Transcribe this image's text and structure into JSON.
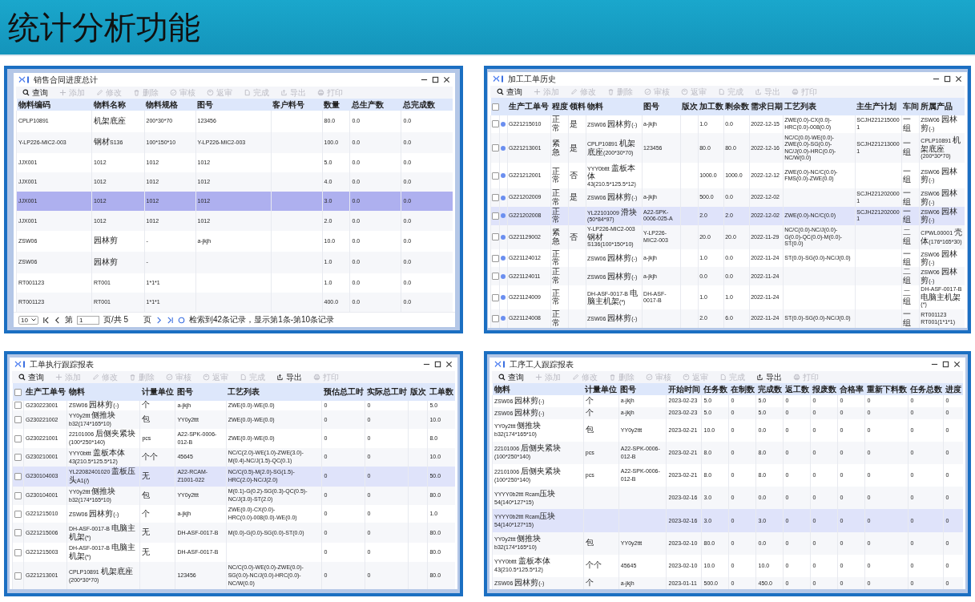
{
  "slide_title": "统计分析功能",
  "windows": [
    {
      "title": "销售合同进度总计",
      "toolbar": [
        {
          "label": "查询",
          "disabled": false
        },
        {
          "label": "添加",
          "disabled": true
        },
        {
          "label": "修改",
          "disabled": true
        },
        {
          "label": "删除",
          "disabled": true
        },
        {
          "label": "审核",
          "disabled": true
        },
        {
          "label": "返审",
          "disabled": true
        },
        {
          "label": "完成",
          "disabled": true
        },
        {
          "label": "导出",
          "disabled": true
        },
        {
          "label": "打印",
          "disabled": true
        }
      ],
      "columns": [
        "物料编码",
        "物料名称",
        "物料规格",
        "图号",
        "客户料号",
        "数量",
        "总生产数",
        "总完成数"
      ],
      "rows": [
        {
          "cells": [
            "CPLP10891",
            "机架底座",
            "200*30*70",
            "123456",
            null,
            "80.0",
            "0.0",
            "0.0"
          ],
          "selected": false
        },
        {
          "cells": [
            "Y-LP226-MIC2-003",
            "钢材S136",
            "100*150*10",
            "Y-LP226-MIC2-003",
            null,
            "100.0",
            "0.0",
            "0.0"
          ],
          "selected": false
        },
        {
          "cells": [
            "JJX001",
            "1012",
            "1012",
            "1012",
            null,
            "5.0",
            "0.0",
            "0.0"
          ],
          "selected": false
        },
        {
          "cells": [
            "JJX001",
            "1012",
            "1012",
            "1012",
            null,
            "4.0",
            "0.0",
            "0.0"
          ],
          "selected": false
        },
        {
          "cells": [
            "JJX001",
            "1012",
            "1012",
            "1012",
            null,
            "3.0",
            "0.0",
            "0.0"
          ],
          "selected": true
        },
        {
          "cells": [
            "JJX001",
            "1012",
            "1012",
            "1012",
            null,
            "2.0",
            "0.0",
            "0.0"
          ],
          "selected": false
        },
        {
          "cells": [
            "ZSW06",
            "园林剪",
            "-",
            "a-jkjh",
            null,
            "10.0",
            "0.0",
            "0.0"
          ],
          "selected": false
        },
        {
          "cells": [
            "ZSW06",
            "园林剪",
            "-",
            null,
            null,
            "1.0",
            "0.0",
            "0.0"
          ],
          "selected": false
        },
        {
          "cells": [
            "RT001123",
            "RT001",
            "1*1*1",
            null,
            null,
            "1.0",
            "0.0",
            "0.0"
          ],
          "selected": false
        },
        {
          "cells": [
            "RT001123",
            "RT001",
            "1*1*1",
            null,
            null,
            "400.0",
            "0.0",
            "0.0"
          ],
          "selected": false
        }
      ],
      "pager": {
        "page_size": "10",
        "before": "第",
        "page": "1",
        "after": "页/共 5",
        "suffix": "页",
        "summary": "检索到42条记录，显示第1条-第10条记录"
      }
    },
    {
      "title": "加工工单历史",
      "all_checked": false,
      "status_dots": true,
      "toolbar": [
        {
          "label": "查询",
          "disabled": false
        },
        {
          "label": "添加",
          "disabled": true
        },
        {
          "label": "修改",
          "disabled": true
        },
        {
          "label": "删除",
          "disabled": true
        },
        {
          "label": "审核",
          "disabled": true
        },
        {
          "label": "返审",
          "disabled": true
        },
        {
          "label": "完成",
          "disabled": true
        },
        {
          "label": "导出",
          "disabled": true
        },
        {
          "label": "打印",
          "disabled": true
        }
      ],
      "columns": [
        "生产工单号",
        "程度",
        "领料",
        "物料",
        "图号",
        "版次",
        "加工数",
        "剩余数",
        "需求日期",
        "工艺列表",
        "主生产计划",
        "车间",
        "所属产品"
      ],
      "rows": [
        {
          "cells": [
            "G221215010",
            "正常",
            "是",
            "ZSW06 园林剪(-)",
            "a-jkjh",
            null,
            "1.0",
            "0.0",
            "2022-12-15",
            "ZWE(0.0)-CX(0.0)-HRC(0.0)-008(0.0)",
            "SCJH2212150001",
            "一组",
            "ZSW06 园林剪(-)"
          ],
          "hovered": false,
          "checked": false
        },
        {
          "cells": [
            "G221213001",
            "紧急",
            "是",
            "CPLP10891 机架底座(200*30*70)",
            "123456",
            null,
            "80.0",
            "80.0",
            "2022-12-16",
            "NC/C(0.0)-WE(0.0)-ZWE(0.0)-SG(0.0)-NC/J(0.0)-HRC(0.0)-NC/W(0.0)",
            "SCJH2212130001",
            "一组",
            "CPLP10891 机架底座(200*30*70)"
          ],
          "hovered": false,
          "checked": false
        },
        {
          "cells": [
            "G221212001",
            "正常",
            "否",
            "YYY0bttt 盖板本体43(210.5*125.5*12)",
            null,
            null,
            "1000.0",
            "1000.0",
            "2022-12-12",
            "ZWE(0.0)-NC/C(0.0)-FMS(0.0)-ZWE(0.0)",
            null,
            "一组",
            "ZSW06 园林剪(-)"
          ],
          "hovered": false,
          "checked": false
        },
        {
          "cells": [
            "G221202009",
            "正常",
            "是",
            "ZSW06 园林剪(-)",
            "a-jkjh",
            null,
            "500.0",
            "0.0",
            "2022-12-02",
            null,
            "SCJH2212020001",
            "一组",
            "ZSW06 园林剪(-)"
          ],
          "hovered": false,
          "checked": false
        },
        {
          "cells": [
            "G221202008",
            "正常",
            null,
            "YL22101009 滑块(50*84*97)",
            "A22-SPK-0006-025-A",
            null,
            "2.0",
            "2.0",
            "2022-12-02",
            "ZWE(0.0)-NC/C(0.0)",
            "SCJH2212020001",
            "一组",
            "ZSW06 园林剪(-)"
          ],
          "hovered": true,
          "checked": false
        },
        {
          "cells": [
            "G221129002",
            "紧急",
            "否",
            "Y-LP226-MIC2-003 钢材S136(100*150*10)",
            "Y-LP226-MIC2-003",
            null,
            "20.0",
            "20.0",
            "2022-11-29",
            "NC/C(0.0)-NC/J(0.0)-G(0.0)-QC(0.0)-M(0.0)-ST(0.0)",
            null,
            "二组",
            "CPWL00001 壳体(176*165*30)"
          ],
          "hovered": false,
          "checked": false
        },
        {
          "cells": [
            "G221124012",
            "正常",
            null,
            "ZSW06 园林剪(-)",
            "a-jkjh",
            null,
            "1.0",
            "0.0",
            "2022-11-24",
            "ST(0.0)-SG(0.0)-NC/J(0.0)",
            null,
            "一组",
            "ZSW06 园林剪(-)"
          ],
          "hovered": false,
          "checked": false
        },
        {
          "cells": [
            "G221124011",
            "正常",
            null,
            "ZSW06 园林剪(-)",
            "a-jkjh",
            null,
            "0.0",
            "0.0",
            "2022-11-24",
            null,
            null,
            "二组",
            "ZSW06 园林剪(-)"
          ],
          "hovered": false,
          "checked": false
        },
        {
          "cells": [
            "G221124009",
            "正常",
            null,
            "DH-ASF-0017-B 电脑主机架(*)",
            "DH-ASF-0017-B",
            null,
            "1.0",
            "1.0",
            "2022-11-24",
            null,
            null,
            "二组",
            "DH-ASF-0017-B 电脑主机架(*)"
          ],
          "hovered": false,
          "checked": false
        },
        {
          "cells": [
            "G221124008",
            "正常",
            null,
            "ZSW06 园林剪(-)",
            null,
            null,
            "2.0",
            "6.0",
            "2022-11-24",
            "ST(0.0)-SG(0.0)-NC/J(0.0)",
            null,
            "一组",
            "RT001123 RT001(1*1*1)"
          ],
          "hovered": false,
          "checked": false
        }
      ]
    },
    {
      "title": "工单执行跟踪报表",
      "all_checked": false,
      "toolbar": [
        {
          "label": "查询",
          "disabled": false
        },
        {
          "label": "添加",
          "disabled": true
        },
        {
          "label": "修改",
          "disabled": true
        },
        {
          "label": "删除",
          "disabled": true
        },
        {
          "label": "审核",
          "disabled": true
        },
        {
          "label": "返审",
          "disabled": true
        },
        {
          "label": "完成",
          "disabled": true
        },
        {
          "label": "导出",
          "disabled": false
        },
        {
          "label": "打印",
          "disabled": true
        }
      ],
      "columns": [
        "生产工单号",
        "物料",
        "计量单位",
        "图号",
        "工艺列表",
        "预估总工时",
        "实际总工时",
        "版次",
        "工单数"
      ],
      "rows": [
        {
          "cells": [
            "G230223001",
            "ZSW06 园林剪(-)",
            "个",
            "a-jkjh",
            "ZWE(0.0)-WE(0.0)",
            "0",
            "0",
            null,
            "5.0"
          ],
          "hovered": false,
          "checked": false
        },
        {
          "cells": [
            "G230221002",
            "YY0y2ttt 侧推块b32(174*165*10)",
            "包",
            "YY0y2ttt",
            "ZWE(0.0)-WE(0.0)",
            "0",
            "0",
            null,
            "10.0"
          ],
          "hovered": false,
          "checked": false
        },
        {
          "cells": [
            "G230221001",
            "22101006 后侧夹紧块(100*250*140)",
            "pcs",
            "A22-SPK-0006-012-B",
            "ZWE(0.0)-WE(0.0)",
            "0",
            "0",
            null,
            "8.0"
          ],
          "hovered": false,
          "checked": false
        },
        {
          "cells": [
            "G230210001",
            "YYY0bttt 盖板本体43(210.5*125.5*12)",
            "个个",
            "45645",
            "NC/C(2.0)-WE(1.0)-ZWE(3.0)-M(0.4)-NC/J(1.5)-QC(0.1)",
            "0",
            "0",
            null,
            "10.0"
          ],
          "hovered": false,
          "checked": false
        },
        {
          "cells": [
            "G230104003",
            "YL22082401020 盖板压头A1(/)",
            "无",
            "A22-RCAM-Z1001-022",
            "NC/C(0.5)-M(2.0)-SG(1.5)-HRC(2.0)-NC/J(2.0)",
            "0",
            "0",
            null,
            "50.0"
          ],
          "hovered": true,
          "checked": false
        },
        {
          "cells": [
            "G230104001",
            "YY0y2ttt 侧推块b32(174*165*10)",
            "包",
            "YY0y2ttt",
            "M(0.1)-G(0.2)-SG(0.3)-QC(0.5)-NC/J(3.0)-ST(2.0)",
            "0",
            "0",
            null,
            "80.0"
          ],
          "hovered": false,
          "checked": false
        },
        {
          "cells": [
            "G221215010",
            "ZSW06 园林剪(-)",
            "个",
            "a-jkjh",
            "ZWE(0.0)-CX(0.0)-HRC(0.0)-008(0.0)-WE(0.0)",
            "0",
            "0",
            null,
            "1.0"
          ],
          "hovered": false,
          "checked": false
        },
        {
          "cells": [
            "G221215006",
            "DH-ASF-0017-B 电脑主机架(*)",
            "无",
            "DH-ASF-0017-B",
            "M(0.0)-G(0.0)-SG(0.0)-ST(0.0)",
            "0",
            "0",
            null,
            "80.0"
          ],
          "hovered": false,
          "checked": false
        },
        {
          "cells": [
            "G221215003",
            "DH-ASF-0017-B 电脑主机架(*)",
            "无",
            "DH-ASF-0017-B",
            null,
            "0",
            "0",
            null,
            "80.0"
          ],
          "hovered": false,
          "checked": false
        },
        {
          "cells": [
            "G221213001",
            "CPLP10891 机架底座(200*30*70)",
            null,
            "123456",
            "NC/C(0.0)-WE(0.0)-ZWE(0.0)-SG(0.0)-NC/J(0.0)-HRC(0.0)-NC/W(0.0)",
            "0",
            "0",
            null,
            "80.0"
          ],
          "hovered": false,
          "checked": false
        }
      ]
    },
    {
      "title": "工序工人跟踪报表",
      "toolbar": [
        {
          "label": "查询",
          "disabled": false
        },
        {
          "label": "添加",
          "disabled": true
        },
        {
          "label": "修改",
          "disabled": true
        },
        {
          "label": "删除",
          "disabled": true
        },
        {
          "label": "审核",
          "disabled": true
        },
        {
          "label": "返审",
          "disabled": true
        },
        {
          "label": "完成",
          "disabled": true
        },
        {
          "label": "导出",
          "disabled": false
        },
        {
          "label": "打印",
          "disabled": true
        }
      ],
      "columns": [
        "物料",
        "计量单位",
        "图号",
        "开始时间",
        "任务数",
        "在制数",
        "完成数",
        "返工数",
        "报废数",
        "合格率",
        "重新下料数",
        "任务总数",
        "进度"
      ],
      "rows": [
        {
          "cells": [
            "ZSW06 园林剪(-)",
            "个",
            "a-jkjh",
            "2023-02-23",
            "5.0",
            "0",
            "5.0",
            "0",
            "0",
            "0",
            "0",
            "0",
            "0"
          ],
          "hovered": false
        },
        {
          "cells": [
            "ZSW06 园林剪(-)",
            "个",
            "a-jkjh",
            "2023-02-23",
            "5.0",
            "0",
            "5.0",
            "0",
            "0",
            "0",
            "0",
            "0",
            "0"
          ],
          "hovered": false
        },
        {
          "cells": [
            "YY0y2ttt 侧推块b32(174*165*10)",
            "包",
            "YY0y2ttt",
            "2023-02-21",
            "10.0",
            "0",
            "0.0",
            "0",
            "0",
            "0",
            "0",
            "0",
            "0"
          ],
          "hovered": false
        },
        {
          "cells": [
            "22101006 后侧夹紧块(100*250*140)",
            "pcs",
            "A22-SPK-0006-012-B",
            "2023-02-21",
            "8.0",
            "0",
            "8.0",
            "0",
            "0",
            "0",
            "0",
            "0",
            "0"
          ],
          "hovered": false
        },
        {
          "cells": [
            "22101006 后侧夹紧块(100*250*140)",
            "pcs",
            "A22-SPK-0006-012-B",
            "2023-02-21",
            "8.0",
            "0",
            "8.0",
            "0",
            "0",
            "0",
            "0",
            "0",
            "0"
          ],
          "hovered": false
        },
        {
          "cells": [
            "YYYY0b2ttt Rcam压块54(140*127*15)",
            null,
            null,
            "2023-02-16",
            "3.0",
            "0",
            "0.0",
            "0",
            "0",
            "0",
            "0",
            "0",
            "0"
          ],
          "hovered": false
        },
        {
          "cells": [
            "YYYY0b2ttt Rcam压块54(140*127*15)",
            null,
            null,
            "2023-02-16",
            "3.0",
            "0",
            "3.0",
            "0",
            "0",
            "0",
            "0",
            "0",
            "0"
          ],
          "hovered": true
        },
        {
          "cells": [
            "YY0y2ttt 侧推块b32(174*165*10)",
            "包",
            "YY0y2ttt",
            "2023-02-10",
            "80.0",
            "0",
            "0.0",
            "0",
            "0",
            "0",
            "0",
            "0",
            "0"
          ],
          "hovered": false
        },
        {
          "cells": [
            "YYY0bttt 盖板本体43(210.5*125.5*12)",
            "个个",
            "45645",
            "2023-02-10",
            "10.0",
            "0",
            "10.0",
            "0",
            "0",
            "0",
            "0",
            "0",
            "0"
          ],
          "hovered": false
        },
        {
          "cells": [
            "ZSW06 园林剪(-)",
            "个",
            "a-jkjh",
            "2023-01-11",
            "500.0",
            "0",
            "450.0",
            "0",
            "0",
            "0",
            "0",
            "0",
            "0"
          ],
          "hovered": false
        }
      ]
    }
  ]
}
